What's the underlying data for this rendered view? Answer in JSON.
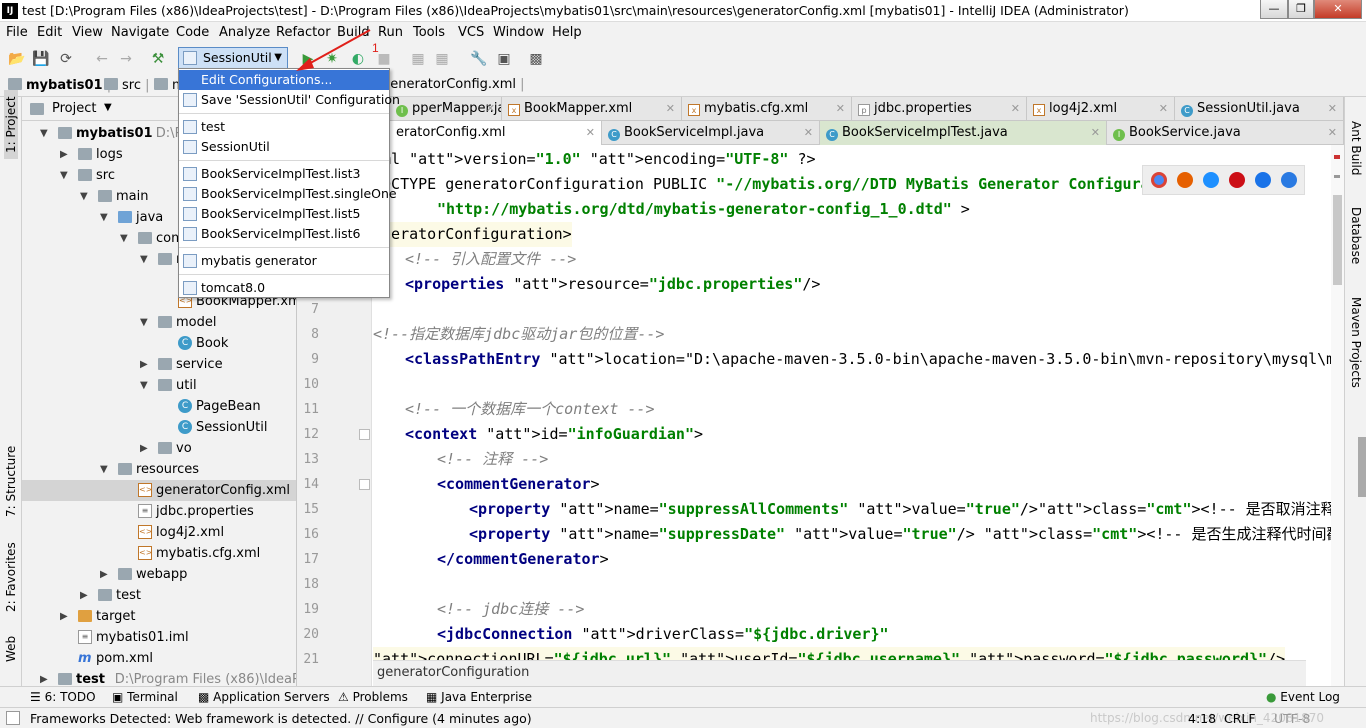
{
  "window": {
    "title": "test [D:\\Program Files (x86)\\IdeaProjects\\test] - D:\\Program Files (x86)\\IdeaProjects\\mybatis01\\src\\main\\resources\\generatorConfig.xml [mybatis01] - IntelliJ IDEA (Administrator)",
    "app_icon": "IJ"
  },
  "menu": [
    "File",
    "Edit",
    "View",
    "Navigate",
    "Code",
    "Analyze",
    "Refactor",
    "Build",
    "Run",
    "Tools",
    "VCS",
    "Window",
    "Help"
  ],
  "toolbar": {
    "run_config": "SessionUtil"
  },
  "annotation": {
    "number": "1"
  },
  "breadcrumb": [
    "mybatis01",
    "src",
    "m",
    "generatorConfig.xml"
  ],
  "left_strip": [
    "1: Project",
    "7: Structure",
    "2: Favorites",
    "Web"
  ],
  "right_strip": [
    "Ant Build",
    "Database",
    "Maven Projects"
  ],
  "project": {
    "header": "Project",
    "tree": [
      {
        "label": "mybatis01",
        "suffix": "D:\\Prog",
        "kind": "folder",
        "indent": 0,
        "arrow": "down",
        "bold": true
      },
      {
        "label": "logs",
        "kind": "folder",
        "indent": 1,
        "arrow": "right"
      },
      {
        "label": "src",
        "kind": "folder",
        "indent": 1,
        "arrow": "down"
      },
      {
        "label": "main",
        "kind": "folder",
        "indent": 2,
        "arrow": "down"
      },
      {
        "label": "java",
        "kind": "src",
        "indent": 3,
        "arrow": "down"
      },
      {
        "label": "com.zl",
        "kind": "folder",
        "indent": 4,
        "arrow": "down"
      },
      {
        "label": "ma",
        "kind": "folder",
        "indent": 5,
        "arrow": "down"
      },
      {
        "label": "",
        "kind": "iface",
        "indent": 6,
        "arrow": ""
      },
      {
        "label": "BookMapper.xml",
        "kind": "xml",
        "indent": 6,
        "arrow": ""
      },
      {
        "label": "model",
        "kind": "folder",
        "indent": 5,
        "arrow": "down"
      },
      {
        "label": "Book",
        "kind": "class",
        "indent": 6,
        "arrow": ""
      },
      {
        "label": "service",
        "kind": "folder",
        "indent": 5,
        "arrow": "right"
      },
      {
        "label": "util",
        "kind": "folder",
        "indent": 5,
        "arrow": "down"
      },
      {
        "label": "PageBean",
        "kind": "class",
        "indent": 6,
        "arrow": ""
      },
      {
        "label": "SessionUtil",
        "kind": "class",
        "indent": 6,
        "arrow": ""
      },
      {
        "label": "vo",
        "kind": "folder",
        "indent": 5,
        "arrow": "right"
      },
      {
        "label": "resources",
        "kind": "folder",
        "indent": 3,
        "arrow": "down"
      },
      {
        "label": "generatorConfig.xml",
        "kind": "xml",
        "indent": 4,
        "arrow": "",
        "selected": true
      },
      {
        "label": "jdbc.properties",
        "kind": "prop",
        "indent": 4,
        "arrow": ""
      },
      {
        "label": "log4j2.xml",
        "kind": "xml",
        "indent": 4,
        "arrow": ""
      },
      {
        "label": "mybatis.cfg.xml",
        "kind": "xml",
        "indent": 4,
        "arrow": ""
      },
      {
        "label": "webapp",
        "kind": "folder",
        "indent": 3,
        "arrow": "right"
      },
      {
        "label": "test",
        "kind": "folder",
        "indent": 2,
        "arrow": "right"
      },
      {
        "label": "target",
        "kind": "orange",
        "indent": 1,
        "arrow": "right"
      },
      {
        "label": "mybatis01.iml",
        "kind": "prop",
        "indent": 1,
        "arrow": ""
      },
      {
        "label": "pom.xml",
        "kind": "m",
        "indent": 1,
        "arrow": ""
      },
      {
        "label": "test",
        "suffix": "D:\\Program Files (x86)\\IdeaProjects",
        "kind": "folder",
        "indent": 0,
        "arrow": "right",
        "bold": true
      }
    ]
  },
  "tabs_row1": [
    {
      "label": "pperMapper.java",
      "icon": "I"
    },
    {
      "label": "BookMapper.xml",
      "icon": "x"
    },
    {
      "label": "mybatis.cfg.xml",
      "icon": "x"
    },
    {
      "label": "jdbc.properties",
      "icon": "p"
    },
    {
      "label": "log4j2.xml",
      "icon": "x"
    },
    {
      "label": "SessionUtil.java",
      "icon": "C"
    }
  ],
  "tabs_row2": [
    {
      "label": "eratorConfig.xml",
      "icon": ""
    },
    {
      "label": "BookServiceImpl.java",
      "icon": "C"
    },
    {
      "label": "BookServiceImplTest.java",
      "icon": "C"
    },
    {
      "label": "BookService.java",
      "icon": "I"
    }
  ],
  "code": [
    {
      "n": "",
      "t": "xml version=\"1.0\" encoding=\"UTF-8\" ?>"
    },
    {
      "n": "",
      "t": "DOCTYPE generatorConfiguration PUBLIC \"-//mybatis.org//DTD MyBatis Generator Configuration 1.0//EN\""
    },
    {
      "n": "",
      "t": "\"http://mybatis.org/dtd/mybatis-generator-config_1_0.dtd\" >"
    },
    {
      "n": "",
      "t": "eneratorConfiguration>"
    },
    {
      "n": "",
      "t": "<!-- 引入配置文件 -->"
    },
    {
      "n": "",
      "t": "<properties resource=\"jdbc.properties\"/>"
    },
    {
      "n": "7",
      "t": ""
    },
    {
      "n": "8",
      "t": "<!--指定数据库jdbc驱动jar包的位置-->"
    },
    {
      "n": "9",
      "t": "<classPathEntry location=\"D:\\apache-maven-3.5.0-bin\\apache-maven-3.5.0-bin\\mvn-repository\\mysql\\mysql-con"
    },
    {
      "n": "10",
      "t": ""
    },
    {
      "n": "11",
      "t": "<!-- 一个数据库一个context -->"
    },
    {
      "n": "12",
      "t": "<context id=\"infoGuardian\">"
    },
    {
      "n": "13",
      "t": "<!-- 注释 -->"
    },
    {
      "n": "14",
      "t": "<commentGenerator>"
    },
    {
      "n": "15",
      "t": "<property name=\"suppressAllComments\" value=\"true\"/><!-- 是否取消注释 -->"
    },
    {
      "n": "16",
      "t": "<property name=\"suppressDate\" value=\"true\"/> <!-- 是否生成注释代时间戳 -->"
    },
    {
      "n": "17",
      "t": "</commentGenerator>"
    },
    {
      "n": "18",
      "t": ""
    },
    {
      "n": "19",
      "t": "<!-- jdbc连接 -->"
    },
    {
      "n": "20",
      "t": "<jdbcConnection driverClass=\"${jdbc.driver}\""
    },
    {
      "n": "21",
      "t": "connectionURL=\"${jdbc.url}\" userId=\"${jdbc.username}\" password=\"${jdbc.password}\"/>"
    }
  ],
  "editor_breadcrumb": "generatorConfiguration",
  "dropdown": {
    "items": [
      {
        "label": "Edit Configurations...",
        "selected": true,
        "group": 0
      },
      {
        "label": "Save 'SessionUtil' Configuration",
        "group": 0
      },
      {
        "label": "test",
        "group": 1
      },
      {
        "label": "SessionUtil",
        "group": 1
      },
      {
        "label": "BookServiceImplTest.list3",
        "group": 2
      },
      {
        "label": "BookServiceImplTest.singleOne",
        "group": 2
      },
      {
        "label": "BookServiceImplTest.list5",
        "group": 2
      },
      {
        "label": "BookServiceImplTest.list6",
        "group": 2
      },
      {
        "label": "mybatis generator",
        "group": 3
      },
      {
        "label": "tomcat8.0",
        "group": 4
      }
    ]
  },
  "bottom_tools": [
    "6: TODO",
    "Terminal",
    "Application Servers",
    "Problems",
    "Java Enterprise",
    "Event Log"
  ],
  "status": {
    "message": "Frameworks Detected: Web framework is detected. // Configure (4 minutes ago)",
    "position": "4:18",
    "line_sep": "CRLF",
    "encoding": "UTF-8",
    "watermark": "https://blog.csdn.net/weixin_42081870"
  }
}
